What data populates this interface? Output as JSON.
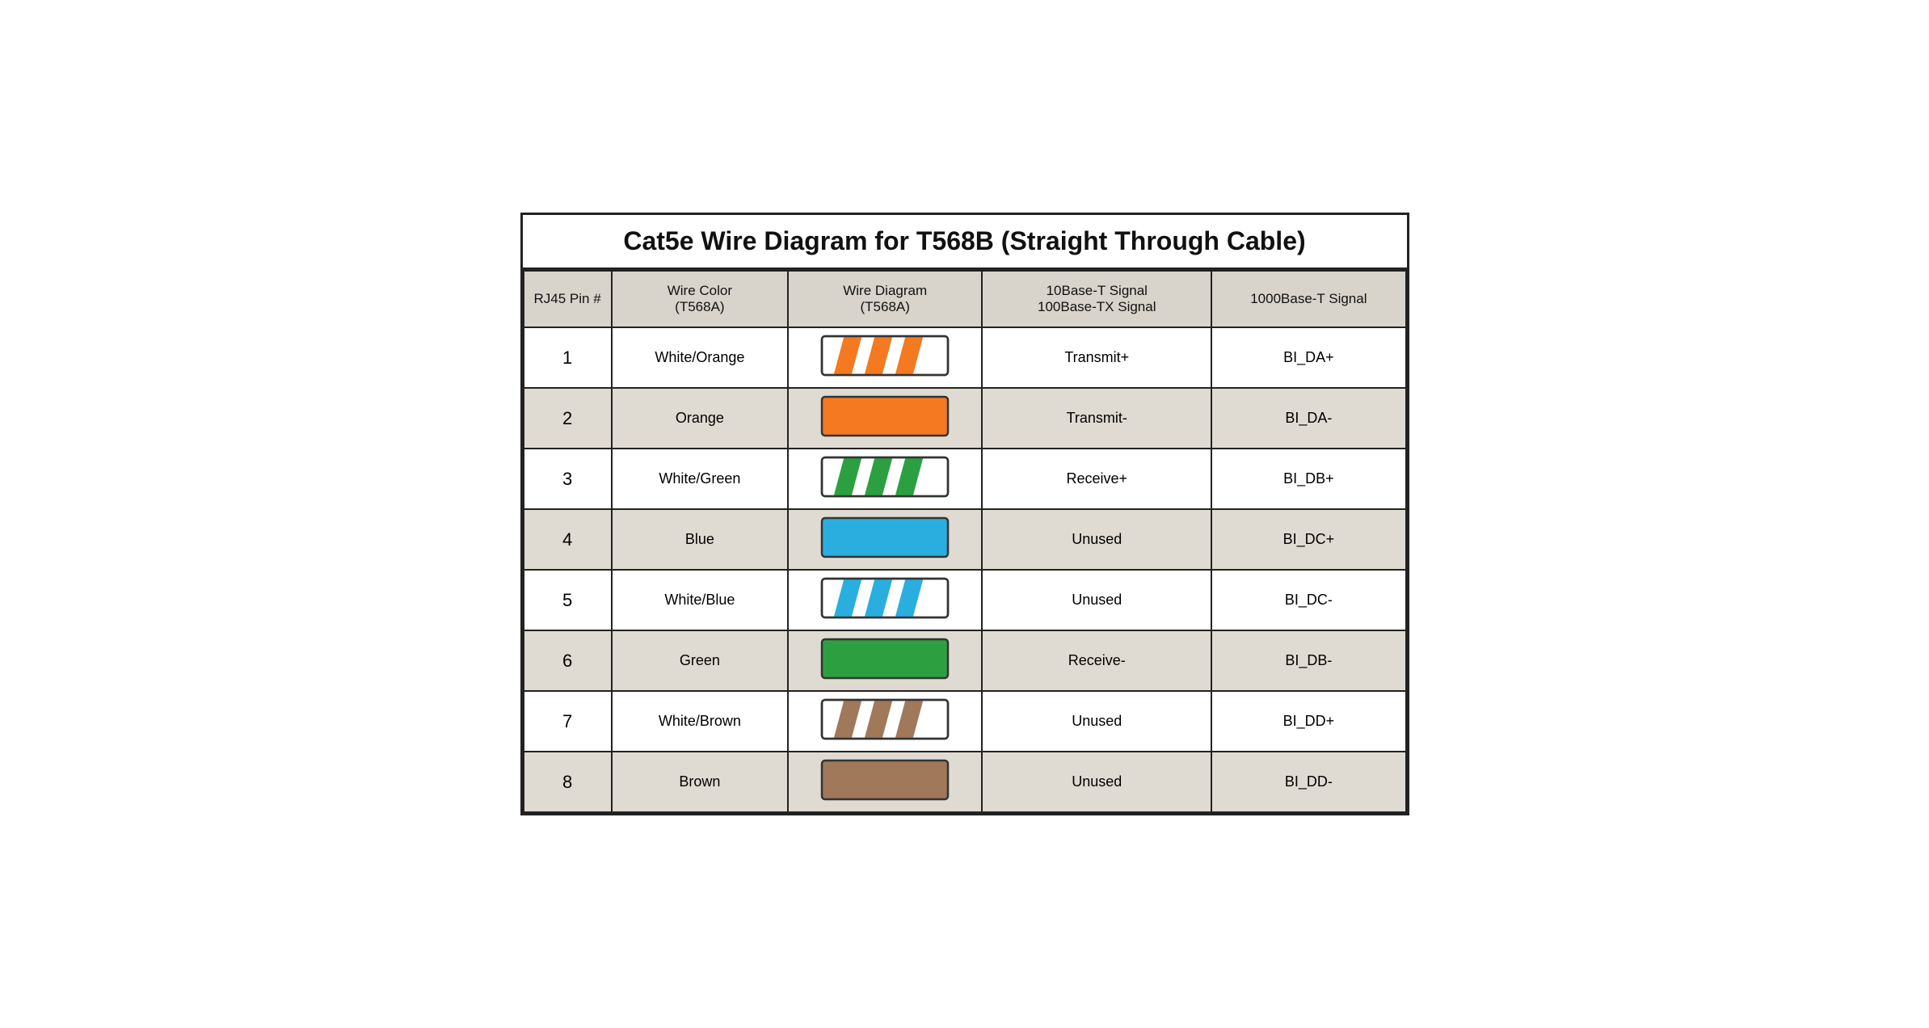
{
  "title": "Cat5e Wire Diagram for T568B (Straight Through Cable)",
  "columns": [
    "RJ45 Pin #",
    "Wire Color\n(T568A)",
    "Wire Diagram\n(T568A)",
    "10Base-T Signal\n100Base-TX Signal",
    "1000Base-T Signal"
  ],
  "rows": [
    {
      "pin": "1",
      "color": "White/Orange",
      "wire_type": "striped",
      "wire_color": "#F47920",
      "signal_10_100": "Transmit+",
      "signal_1000": "BI_DA+"
    },
    {
      "pin": "2",
      "color": "Orange",
      "wire_type": "solid",
      "wire_color": "#F47920",
      "signal_10_100": "Transmit-",
      "signal_1000": "BI_DA-"
    },
    {
      "pin": "3",
      "color": "White/Green",
      "wire_type": "striped",
      "wire_color": "#2CA040",
      "signal_10_100": "Receive+",
      "signal_1000": "BI_DB+"
    },
    {
      "pin": "4",
      "color": "Blue",
      "wire_type": "solid",
      "wire_color": "#2AAEE0",
      "signal_10_100": "Unused",
      "signal_1000": "BI_DC+"
    },
    {
      "pin": "5",
      "color": "White/Blue",
      "wire_type": "striped",
      "wire_color": "#2AAEE0",
      "signal_10_100": "Unused",
      "signal_1000": "BI_DC-"
    },
    {
      "pin": "6",
      "color": "Green",
      "wire_type": "solid",
      "wire_color": "#2CA040",
      "signal_10_100": "Receive-",
      "signal_1000": "BI_DB-"
    },
    {
      "pin": "7",
      "color": "White/Brown",
      "wire_type": "striped",
      "wire_color": "#A0785A",
      "signal_10_100": "Unused",
      "signal_1000": "BI_DD+"
    },
    {
      "pin": "8",
      "color": "Brown",
      "wire_type": "solid",
      "wire_color": "#A0785A",
      "signal_10_100": "Unused",
      "signal_1000": "BI_DD-"
    }
  ]
}
